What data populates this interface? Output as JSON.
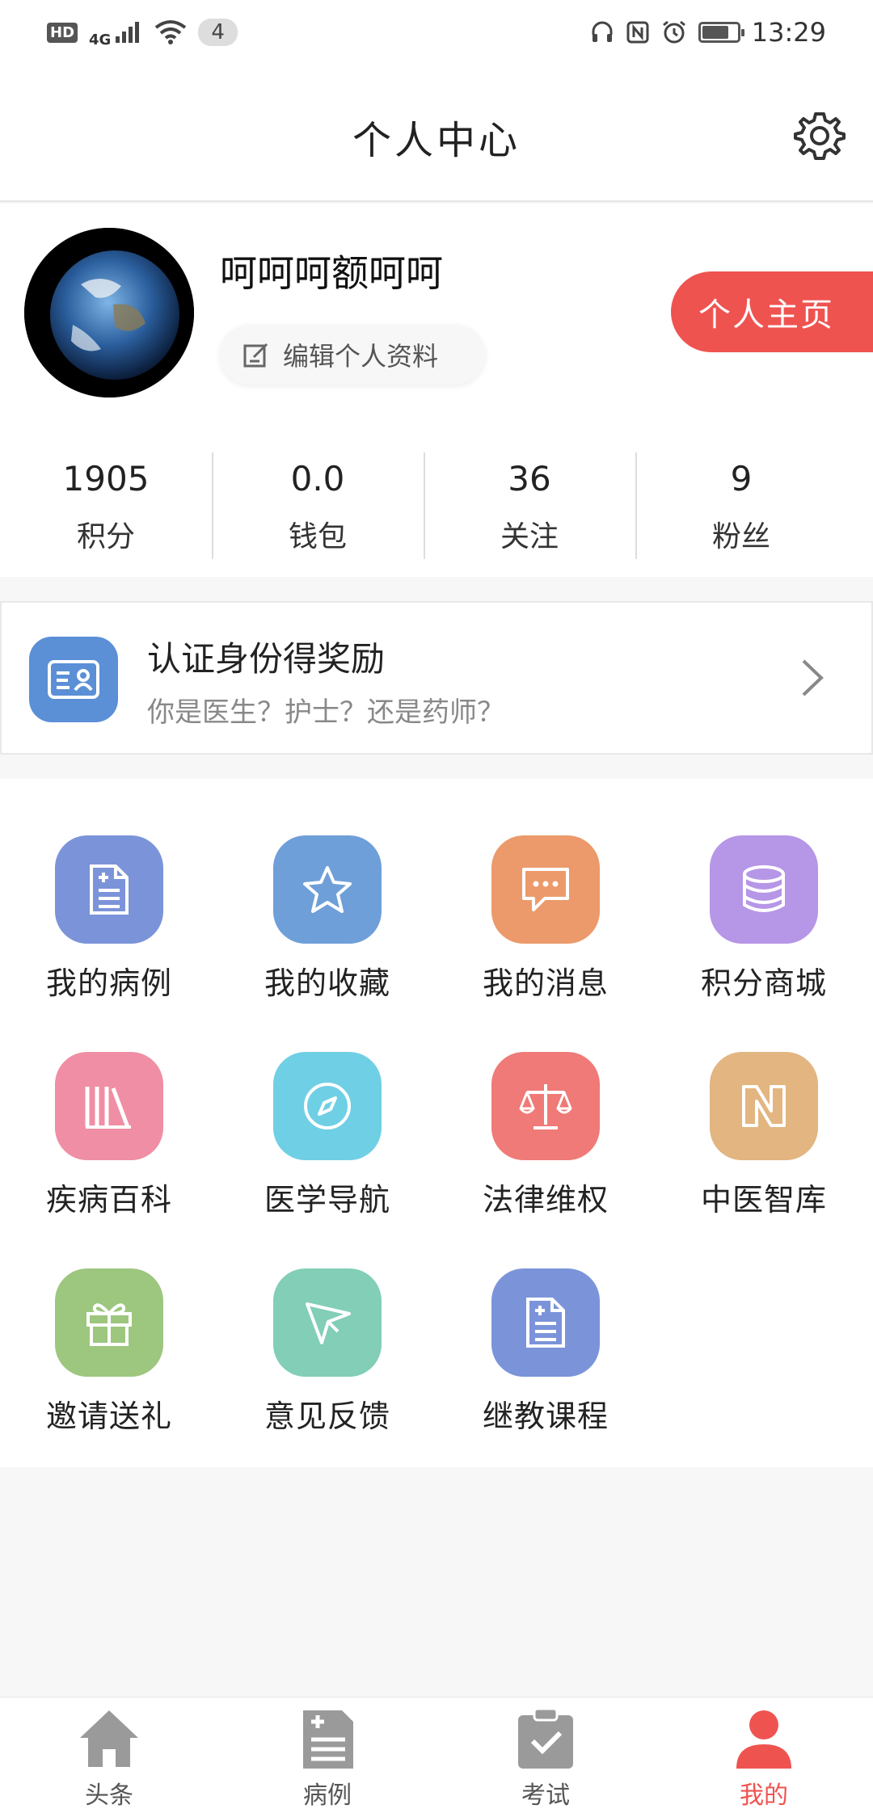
{
  "status_bar": {
    "hd": "HD",
    "network": "4G",
    "badge": "4",
    "time": "13:29",
    "battery_level": 0.75,
    "icons": [
      "headset-icon",
      "nfc-icon",
      "alarm-icon",
      "battery-icon"
    ]
  },
  "header": {
    "title": "个人中心",
    "settings_icon": "gear-icon"
  },
  "profile": {
    "username": "呵呵呵额呵呵",
    "edit_label": "编辑个人资料",
    "home_button": "个人主页",
    "accent_color": "#ef5350"
  },
  "stats": [
    {
      "value": "1905",
      "label": "积分"
    },
    {
      "value": "0.0",
      "label": "钱包"
    },
    {
      "value": "36",
      "label": "关注"
    },
    {
      "value": "9",
      "label": "粉丝"
    }
  ],
  "certification": {
    "title": "认证身份得奖励",
    "subtitle": "你是医生？护士？还是药师？",
    "icon": "id-card-icon",
    "icon_color": "#5b8fd6"
  },
  "menu": [
    {
      "label": "我的病例",
      "icon": "document-plus-icon",
      "color": "#7b94d9"
    },
    {
      "label": "我的收藏",
      "icon": "star-icon",
      "color": "#6f9fd8"
    },
    {
      "label": "我的消息",
      "icon": "chat-icon",
      "color": "#ec9a6b"
    },
    {
      "label": "积分商城",
      "icon": "coins-icon",
      "color": "#b696e6"
    },
    {
      "label": "疾病百科",
      "icon": "books-icon",
      "color": "#ef8ea4"
    },
    {
      "label": "医学导航",
      "icon": "compass-icon",
      "color": "#6fcfe4"
    },
    {
      "label": "法律维权",
      "icon": "scales-icon",
      "color": "#ef7a77"
    },
    {
      "label": "中医智库",
      "icon": "n-logo-icon",
      "color": "#e2b581"
    },
    {
      "label": "邀请送礼",
      "icon": "gift-icon",
      "color": "#9dc67f"
    },
    {
      "label": "意见反馈",
      "icon": "paper-plane-icon",
      "color": "#82ceb7"
    },
    {
      "label": "继教课程",
      "icon": "document-plus-icon",
      "color": "#7b94d9"
    }
  ],
  "tabs": [
    {
      "label": "头条",
      "icon": "home-icon",
      "active": false
    },
    {
      "label": "病例",
      "icon": "case-icon",
      "active": false
    },
    {
      "label": "考试",
      "icon": "exam-icon",
      "active": false
    },
    {
      "label": "我的",
      "icon": "user-icon",
      "active": true
    }
  ]
}
